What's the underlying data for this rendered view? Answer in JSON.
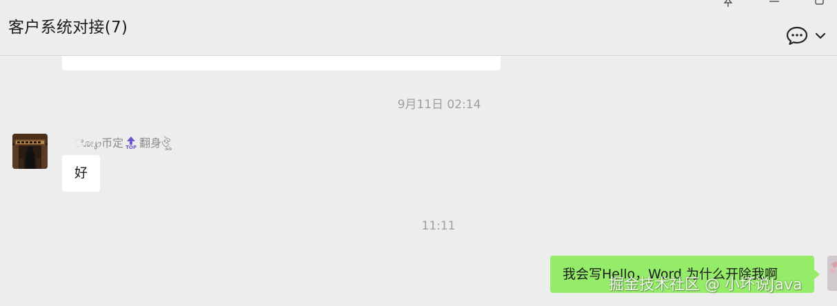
{
  "header": {
    "title": "客户系统对接(7)",
    "icons": [
      "pin-icon",
      "minimize-icon",
      "maximize-icon",
      "chat-bubble-icon",
      "chevron-down-icon"
    ]
  },
  "messages": {
    "timestamp_1": "9月11日 02:14",
    "sender_name_prefix": "ೋ℘币定",
    "sender_badge": "TOP",
    "sender_name_suffix": "翻身ঔৣ",
    "incoming_text": "好",
    "timestamp_2": "11:11",
    "outgoing_text": "我会写Hello，Word 为什么开除我啊"
  },
  "watermark": "掘金技术社区 @ 小坏说Java",
  "colors": {
    "background": "#ededed",
    "incoming_bubble": "#ffffff",
    "outgoing_bubble": "#95ec69",
    "timestamp": "#9e9e9e",
    "badge": "#6b57c9"
  }
}
